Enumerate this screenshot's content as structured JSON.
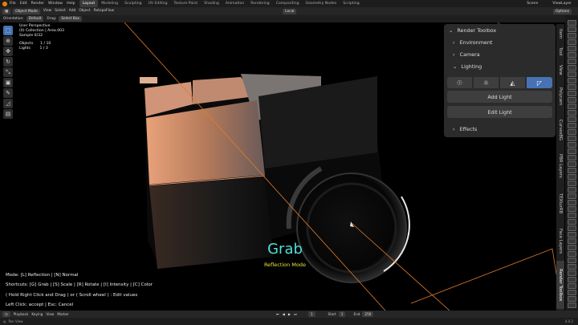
{
  "menubar": {
    "menus": [
      "File",
      "Edit",
      "Render",
      "Window",
      "Help"
    ],
    "workspaces": [
      "Layout",
      "Modeling",
      "Sculpting",
      "UV Editing",
      "Texture Paint",
      "Shading",
      "Animation",
      "Rendering",
      "Compositing",
      "Geometry Nodes",
      "Scripting"
    ],
    "active_workspace": "Layout",
    "scene": "Scene",
    "view_layer": "ViewLayer"
  },
  "header": {
    "mode": "Object Mode",
    "menus": [
      "View",
      "Select",
      "Add",
      "Object"
    ],
    "extra": "RetopoFlow",
    "transform": "Local",
    "options": "Options"
  },
  "toolrow": {
    "orientation_label": "Orientation:",
    "orientation_value": "Default",
    "drag_label": "Drag:",
    "drag_value": "Select Box"
  },
  "viewport_info": {
    "perspective": "User Perspective",
    "collection": "(0) Collection | Area.003",
    "sample": "Sample 0/32",
    "objects": "Objects      1 / 10",
    "lights": "Lights        1 / 3"
  },
  "panel": {
    "title": "Render Toolbox",
    "sections": {
      "environment": "Environment",
      "camera": "Camera",
      "lighting": "Lighting",
      "effects": "Effects"
    },
    "add_light": "Add Light",
    "edit_light": "Edit Light"
  },
  "side_tabs": [
    "Item",
    "Tool",
    "View",
    "Polycam",
    "CurvesBG",
    "PBR Layers",
    "TEXturRB",
    "Face Layers",
    "Render Toolbox"
  ],
  "overlay": {
    "title": "Grab",
    "subtitle": "Reflection Mode"
  },
  "help": {
    "mode": "Mode: [L] Reflection | [N] Normal",
    "shortcuts": "Shortcuts: [G] Grab | [S] Scale | [R] Rotate | [I] Intensity | [C] Color",
    "edit": "( Hold Right Click and Drag ) or ( Scroll wheel ) : Edit values",
    "clicks": "Left Click: accept | Esc: Cancel"
  },
  "timeline": {
    "items": [
      "Playback",
      "Keying",
      "View",
      "Marker"
    ],
    "frame_current": "1",
    "start_label": "Start",
    "start": "1",
    "end_label": "End",
    "end": "250"
  },
  "statusbar": {
    "left": "Pan View",
    "right": "4.0.2"
  },
  "colors": {
    "accent": "#4772b3",
    "grab_text": "#4fe0d8",
    "mode_text": "#e8e43a",
    "light_line": "#e07b2a"
  }
}
